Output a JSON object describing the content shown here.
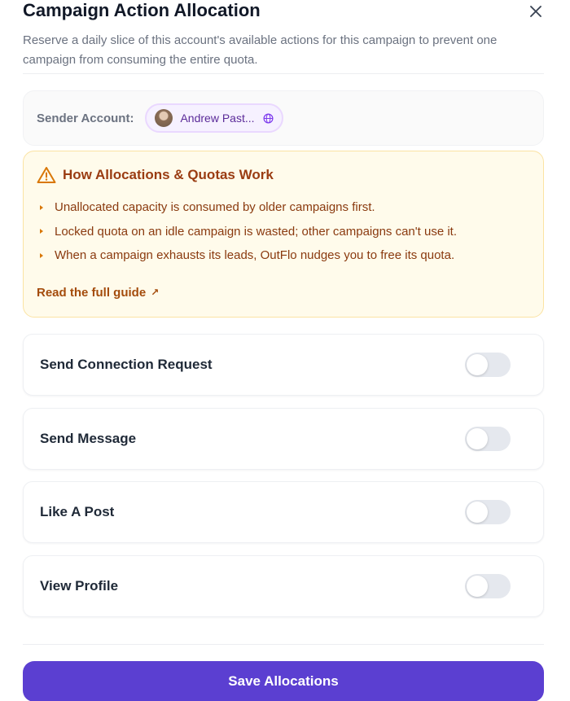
{
  "header": {
    "title": "Campaign Action Allocation",
    "subtitle": "Reserve a daily slice of this account's available actions for this campaign to prevent one campaign from consuming the entire quota."
  },
  "sender": {
    "label": "Sender Account:",
    "account_name": "Andrew Past...",
    "globe_icon": "globe-icon"
  },
  "callout": {
    "title": "How Allocations & Quotas Work",
    "icon": "warning-triangle-icon",
    "items": [
      "Unallocated capacity is consumed by older campaigns first.",
      "Locked quota on an idle campaign is wasted; other campaigns can't use it.",
      "When a campaign exhausts its leads, OutFlo nudges you to free its quota."
    ],
    "link_label": "Read the full guide",
    "link_arrow": "↗"
  },
  "actions": [
    {
      "label": "Send Connection Request",
      "enabled": false
    },
    {
      "label": "Send Message",
      "enabled": false
    },
    {
      "label": "Like A Post",
      "enabled": false
    },
    {
      "label": "View Profile",
      "enabled": false
    }
  ],
  "footer": {
    "save_label": "Save Allocations"
  },
  "colors": {
    "primary": "#5b3fd1",
    "callout_bg": "#fffbeb",
    "callout_text": "#9a3c12",
    "toggle_off": "#e5e8ee"
  }
}
